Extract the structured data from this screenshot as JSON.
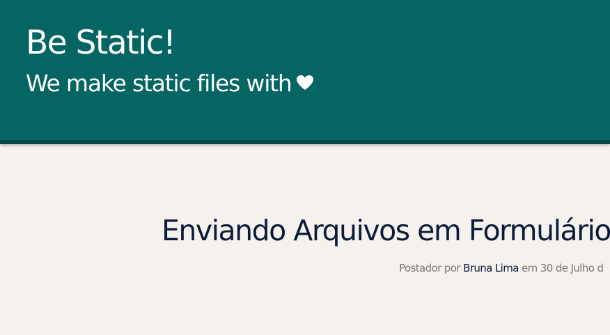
{
  "header": {
    "title": "Be Static!",
    "tagline": "We make static files with",
    "tagline_icon": "heart-icon",
    "background_color": "#046563"
  },
  "post": {
    "title": "Enviando Arquivos em Formulário",
    "meta_prefix": "Postador por",
    "author": "Bruna Lima",
    "date_text": "em 30 de Julho d",
    "title_color": "#0d1b3b"
  }
}
